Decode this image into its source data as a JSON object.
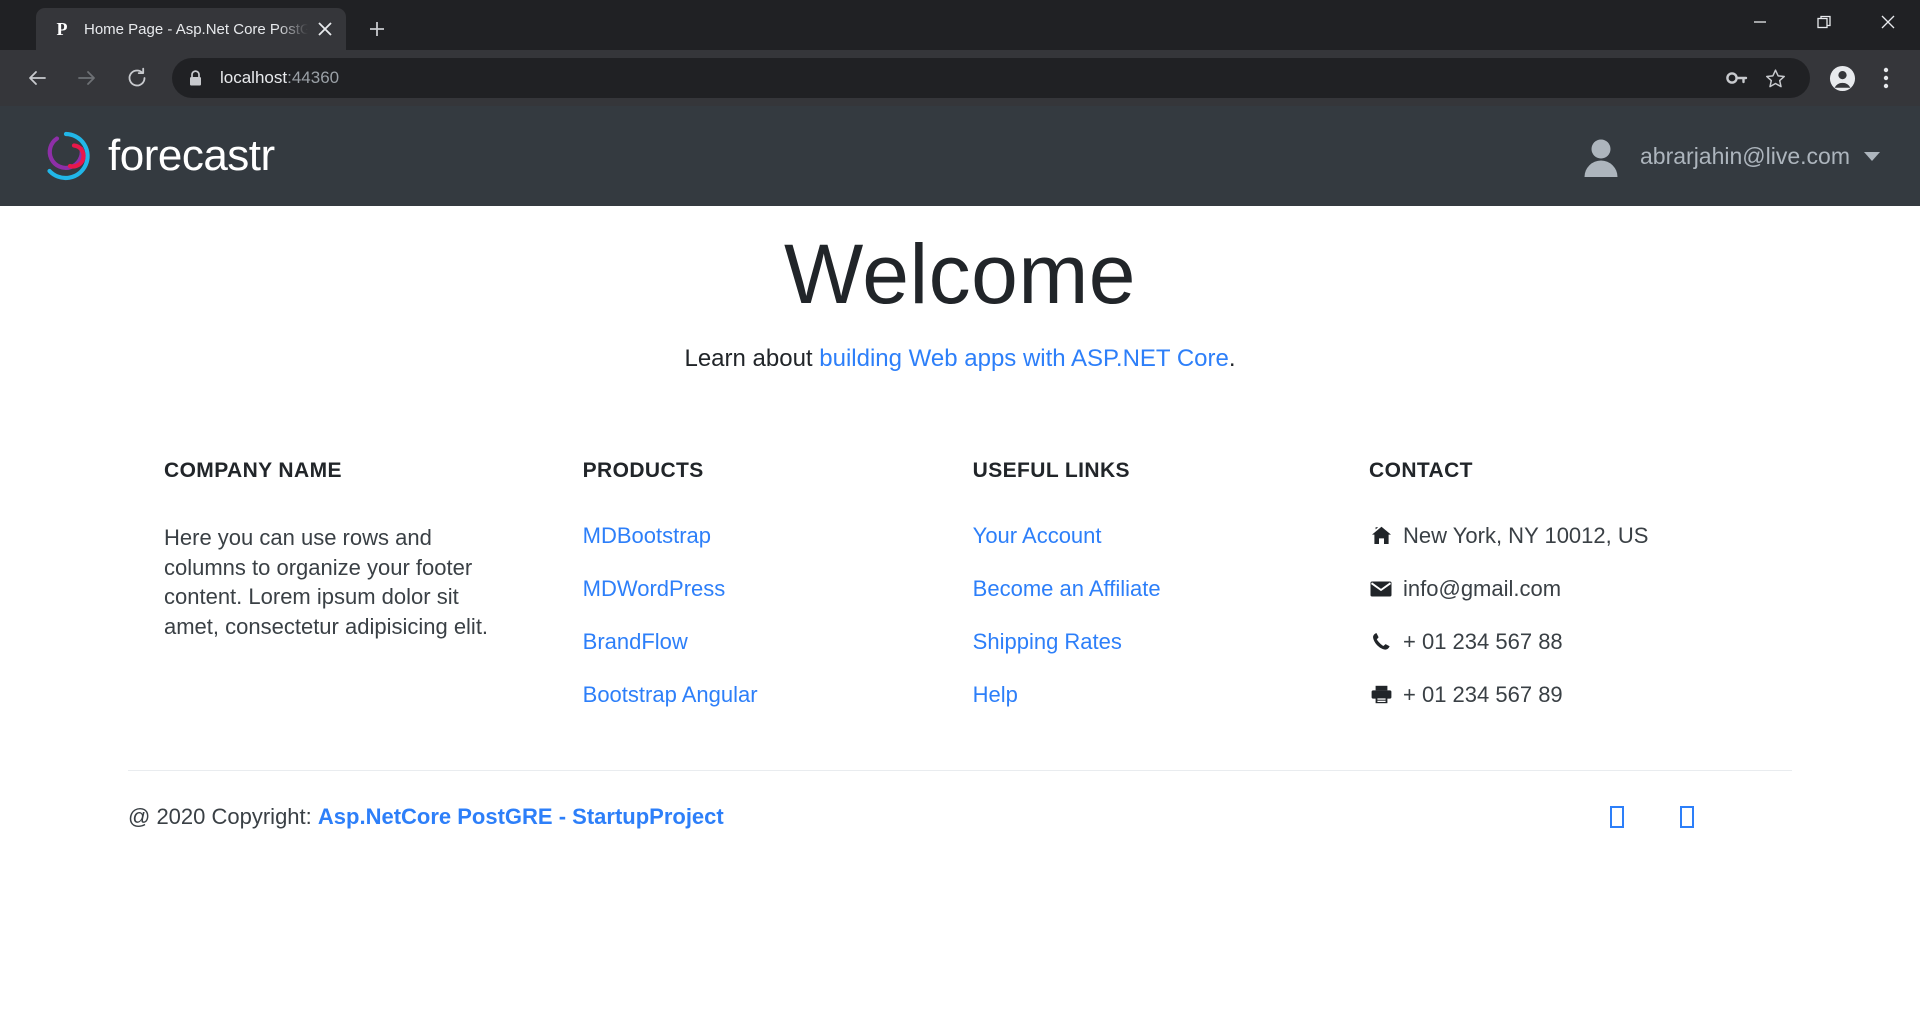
{
  "browser": {
    "tab": {
      "favicon_letter": "P",
      "title": "Home Page - Asp.Net Core PostG",
      "close_icon": "close-icon"
    },
    "new_tab_label": "+",
    "window_controls": {
      "minimize": "—",
      "maximize": "restore-icon",
      "close": "✕"
    },
    "toolbar": {
      "back": "back-arrow-icon",
      "forward": "forward-arrow-icon",
      "reload": "reload-icon",
      "lock": "lock-icon",
      "url_host": "localhost",
      "url_port": ":44360",
      "key_icon": "key-icon",
      "star_icon": "star-icon",
      "profile_icon": "profile-avatar-icon",
      "menu_icon": "three-dot-menu-icon"
    }
  },
  "colors": {
    "navbar_bg": "#343a40",
    "link_blue": "#2d7ff9",
    "logo_cyan": "#21b6e8",
    "logo_purple": "#8e2fa8",
    "logo_crimson": "#e8174a",
    "text_dark": "#212529"
  },
  "navbar": {
    "brand_name": "forecastr",
    "brand_logo": "forecastr-spiral-logo",
    "user_email": "abrarjahin@live.com",
    "user_avatar": "user-avatar-icon",
    "dropdown_caret": "chevron-down-icon"
  },
  "hero": {
    "title": "Welcome",
    "sub_prefix": "Learn about ",
    "sub_link": "building Web apps with ASP.NET Core",
    "sub_suffix": "."
  },
  "footer": {
    "columns": [
      {
        "heading": "Company name",
        "body": "Here you can use rows and columns to organize your footer content. Lorem ipsum dolor sit amet, consectetur adipisicing elit."
      },
      {
        "heading": "Products",
        "links": [
          "MDBootstrap",
          "MDWordPress",
          "BrandFlow",
          "Bootstrap Angular"
        ]
      },
      {
        "heading": "Useful links",
        "links": [
          "Your Account",
          "Become an Affiliate",
          "Shipping Rates",
          "Help"
        ]
      },
      {
        "heading": "Contact",
        "items": [
          {
            "icon": "home-icon",
            "text": "New York, NY 10012, US"
          },
          {
            "icon": "envelope-icon",
            "text": "info@gmail.com"
          },
          {
            "icon": "phone-icon",
            "text": "+ 01 234 567 88"
          },
          {
            "icon": "printer-icon",
            "text": "+ 01 234 567 89"
          }
        ]
      }
    ]
  },
  "copyright": {
    "prefix": "@ 2020 Copyright: ",
    "link": "Asp.NetCore PostGRE - StartupProject",
    "social": [
      {
        "name": "social-icon-1",
        "glyph": ""
      },
      {
        "name": "social-icon-2",
        "glyph": ""
      }
    ]
  }
}
